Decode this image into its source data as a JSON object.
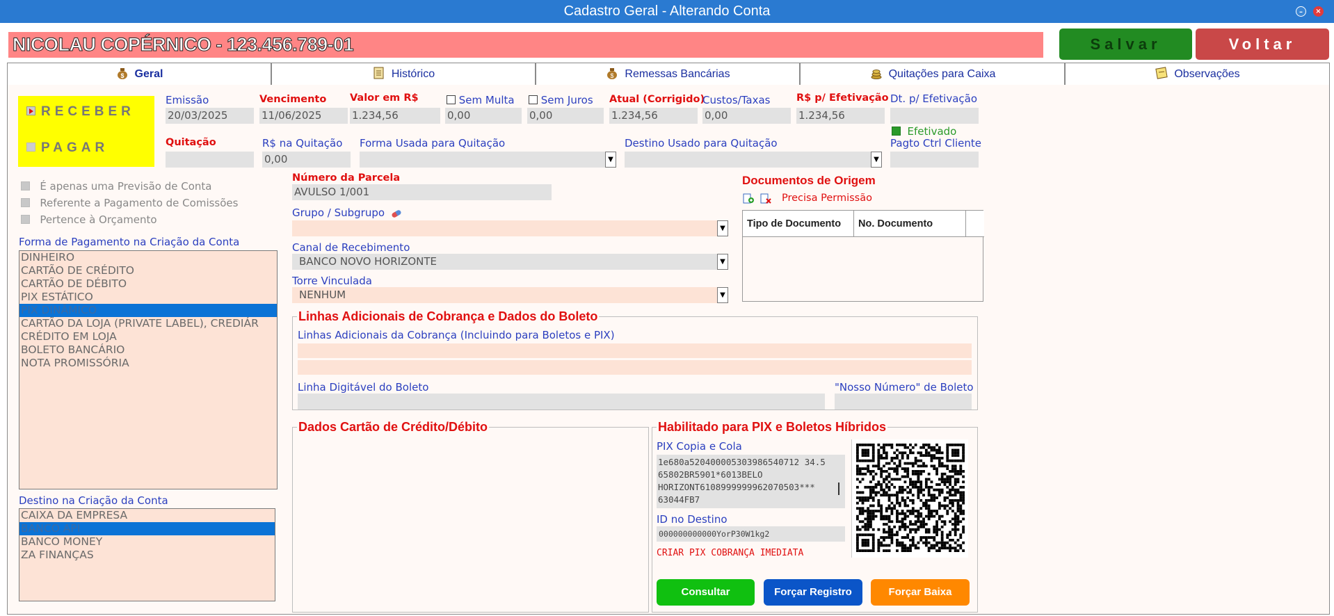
{
  "window": {
    "title": "Cadastro Geral - Alterando Conta"
  },
  "header": {
    "account_name": "NICOLAU COPÉRNICO - 123.456.789-01",
    "save_label": "Salvar",
    "back_label": "Voltar"
  },
  "tabs": [
    {
      "label": "Geral",
      "icon": "money-bag-icon"
    },
    {
      "label": "Histórico",
      "icon": "document-icon"
    },
    {
      "label": "Remessas Bancárias",
      "icon": "money-bag-icon"
    },
    {
      "label": "Quitações para Caixa",
      "icon": "coins-icon"
    },
    {
      "label": "Observações",
      "icon": "notepad-icon"
    }
  ],
  "type_toggle": {
    "receber": "RECEBER",
    "pagar": "PAGAR"
  },
  "fields": {
    "emissao": {
      "label": "Emissão",
      "value": "20/03/2025"
    },
    "vencimento": {
      "label": "Vencimento",
      "value": "11/06/2025"
    },
    "valor": {
      "label": "Valor em R$",
      "value": "1.234,56"
    },
    "sem_multa": {
      "label": "Sem Multa",
      "value": "0,00"
    },
    "sem_juros": {
      "label": "Sem Juros",
      "value": "0,00"
    },
    "atual": {
      "label": "Atual (Corrigido)",
      "value": "1.234,56"
    },
    "custos": {
      "label": "Custos/Taxas",
      "value": "0,00"
    },
    "rs_efetivacao": {
      "label": "R$ p/ Efetivação",
      "value": "1.234,56"
    },
    "dt_efetivacao": {
      "label": "Dt. p/ Efetivação",
      "value": ""
    },
    "efetivado": {
      "label": "Efetivado"
    },
    "quitacao": {
      "label": "Quitação",
      "value": ""
    },
    "rs_quitacao": {
      "label": "R$ na Quitação",
      "value": "0,00"
    },
    "forma_quitacao": {
      "label": "Forma Usada para Quitação",
      "value": ""
    },
    "destino_quitacao": {
      "label": "Destino Usado para Quitação",
      "value": ""
    },
    "pagto_ctrl": {
      "label": "Pagto Ctrl Cliente",
      "value": ""
    }
  },
  "options": {
    "previsao": "É apenas uma Previsão de Conta",
    "comissoes": "Referente a Pagamento de Comissões",
    "orcamento": "Pertence à Orçamento"
  },
  "forma_pagamento": {
    "label": "Forma de Pagamento na Criação da Conta",
    "items": [
      "DINHEIRO",
      "CARTÃO DE CRÉDITO",
      "CARTÃO DE DÉBITO",
      "PIX ESTÁTICO",
      "PIX DINÂMICO",
      "CARTÃO DA LOJA (PRIVATE LABEL), CREDIÁR",
      "CRÉDITO EM LOJA",
      "BOLETO BANCÁRIO",
      "NOTA PROMISSÓRIA"
    ],
    "selected": "PIX DINÂMICO"
  },
  "destino_criacao": {
    "label": "Destino na Criação da Conta",
    "items": [
      "CAIXA DA EMPRESA",
      "BANCO API",
      "BANCO MONEY",
      "ZA FINANÇAS"
    ],
    "selected": "BANCO API"
  },
  "parcela": {
    "label": "Número da Parcela",
    "value": "AVULSO 1/001"
  },
  "grupo": {
    "label": "Grupo / Subgrupo",
    "value": ""
  },
  "canal": {
    "label": "Canal de Recebimento",
    "value": "BANCO NOVO HORIZONTE"
  },
  "torre": {
    "label": "Torre Vinculada",
    "value": "NENHUM"
  },
  "documentos": {
    "title": "Documentos de Origem",
    "permission": "Precisa Permissão",
    "columns": [
      "Tipo de Documento",
      "No. Documento"
    ]
  },
  "boleto": {
    "title": "Linhas Adicionais de Cobrança e Dados do Boleto",
    "linhas_label": "Linhas Adicionais da Cobrança (Incluindo para Boletos e PIX)",
    "linha_digitavel_label": "Linha Digitável do Boleto",
    "nosso_numero_label": "\"Nosso Número\" de Boleto"
  },
  "cartao": {
    "title": "Dados Cartão de Crédito/Débito"
  },
  "pix": {
    "title": "Habilitado para PIX e Boletos Híbridos",
    "copia_cola_label": "PIX Copia e Cola",
    "copia_cola_lines": [
      "1e680a520400005303986540712 34.5",
      "65802BR5901*6013BELO",
      "HORIZONT6108999999962070503***",
      "63044FB7"
    ],
    "id_label": "ID no Destino",
    "id_value": "000000000000YorP30W1kg2",
    "create_label": "CRIAR PIX COBRANÇA IMEDIATA",
    "consultar": "Consultar",
    "forcar_registro": "Forçar Registro",
    "forcar_baixa": "Forçar Baixa"
  },
  "colors": {
    "titlebar": "#2a7ad1",
    "save": "#228b22",
    "back": "#c94848",
    "consultar": "#10c010",
    "registro": "#0b55c8",
    "baixa": "#ff8800"
  }
}
